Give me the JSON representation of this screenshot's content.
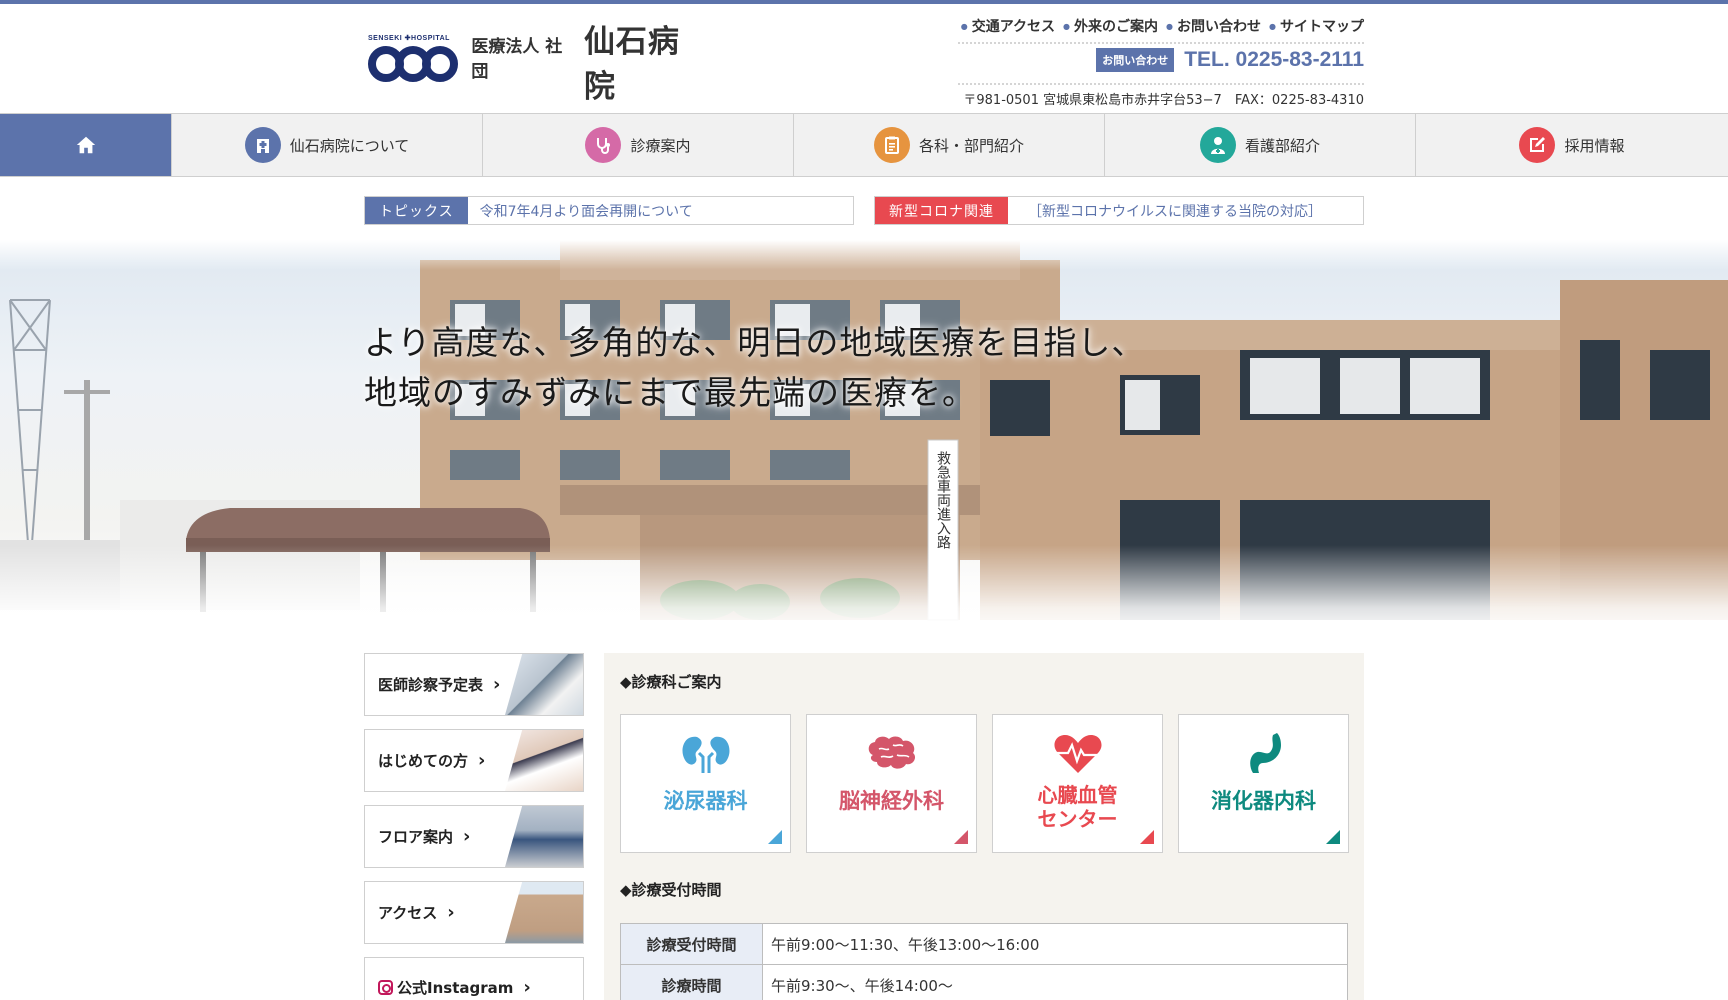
{
  "header": {
    "logo_en": "SENSEKI ✚HOSPITAL",
    "logo_corp": "医療法人 社団",
    "logo_name": "仙石病院",
    "util_links": [
      "交通アクセス",
      "外来のご案内",
      "お問い合わせ",
      "サイトマップ"
    ],
    "tel_badge": "お問い合わせ",
    "tel": "TEL. 0225-83-2111",
    "address": "〒981-0501 宮城県東松島市赤井字台53−7　FAX：0225-83-4310"
  },
  "nav": {
    "items": [
      {
        "label": "仙石病院について",
        "icon": "hospital-icon",
        "color": "#5c73ab"
      },
      {
        "label": "診療案内",
        "icon": "stethoscope-icon",
        "color": "#d56aa7"
      },
      {
        "label": "各科・部門紹介",
        "icon": "clipboard-icon",
        "color": "#e6943f"
      },
      {
        "label": "看護部紹介",
        "icon": "nurse-icon",
        "color": "#23a89a"
      },
      {
        "label": "採用情報",
        "icon": "edit-icon",
        "color": "#e84950"
      }
    ]
  },
  "topics": [
    {
      "tag": "トピックス",
      "text": "令和7年4月より面会再開について"
    },
    {
      "tag": "新型コロナ関連",
      "text": "［新型コロナウイルスに関連する当院の対応］"
    }
  ],
  "hero": {
    "line1": "より高度な、多角的な、明日の地域医療を目指し、",
    "line2": "地域のすみずみにまで最先端の医療を。",
    "sign": "救急車両進入路"
  },
  "side": {
    "items": [
      "医師診察予定表",
      "はじめての方",
      "フロア案内",
      "アクセス"
    ],
    "instagram": "公式Instagram"
  },
  "main": {
    "dept_title": "◆診療科ご案内",
    "depts": [
      {
        "label": "泌尿器科",
        "color": "#4aa6d8"
      },
      {
        "label": "脳神経外科",
        "color": "#d4566a"
      },
      {
        "label": "心臓血管\nセンター",
        "color": "#e84950"
      },
      {
        "label": "消化器内科",
        "color": "#0e8a7f"
      }
    ],
    "hours_title": "◆診療受付時間",
    "hours": [
      {
        "head": "診療受付時間",
        "value": "午前9:00～11:30、午後13:00～16:00"
      },
      {
        "head": "診療時間",
        "value": "午前9:30～、午後14:00～"
      }
    ]
  }
}
